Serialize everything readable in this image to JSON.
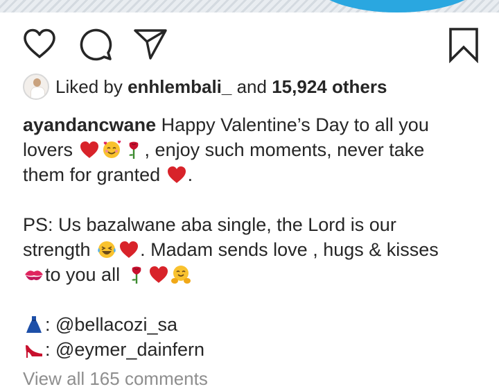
{
  "post": {
    "liked_by": {
      "prefix": "Liked by",
      "user": "enhlembali_",
      "conjunction": "and",
      "others": "15,924 others"
    },
    "caption": {
      "username": "ayandancwane",
      "line1": "Happy Valentine’s Day to all you",
      "line2_a": "lovers",
      "line2_b": ", enjoy such moments, never take",
      "line3_a": "them for granted",
      "line3_b": ".",
      "line4": "PS: Us bazalwane aba single, the Lord is our",
      "line5_a": "strength",
      "line5_b": ". Madam sends love , hugs & kisses",
      "line6": "to you all",
      "credit_dress": ": @bellacozi_sa",
      "credit_shoes": ": @eymer_dainfern"
    },
    "view_comments": "View all 165 comments"
  },
  "icons": {
    "like": "heart-outline-icon",
    "comment": "speech-bubble-icon",
    "share": "paper-plane-icon",
    "save": "bookmark-icon"
  },
  "colors": {
    "text": "#262626",
    "muted": "#8e8e8e",
    "heart": "#d8232a",
    "pool": "#2aa7e0"
  }
}
